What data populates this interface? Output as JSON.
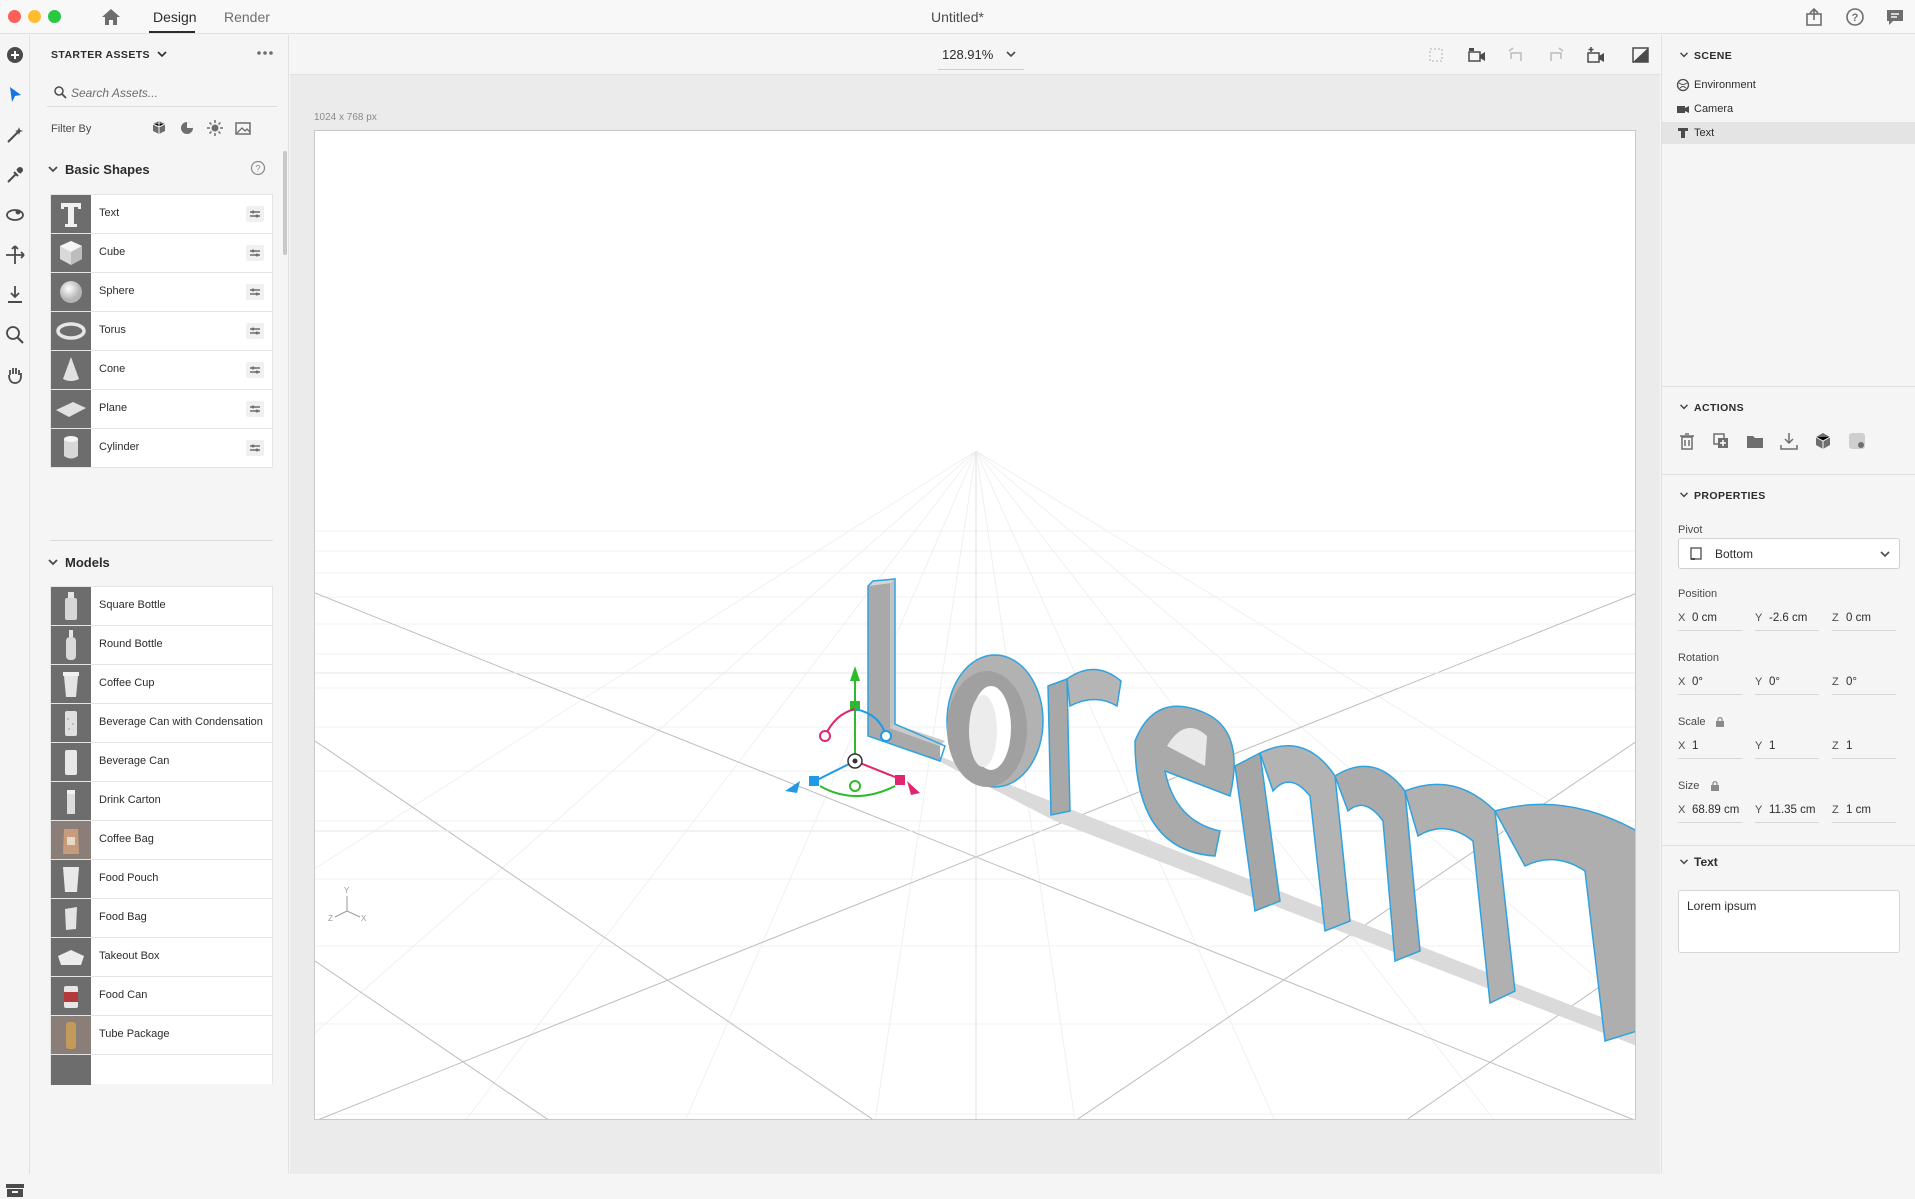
{
  "window": {
    "title": "Untitled*",
    "tabs": [
      {
        "label": "Design",
        "active": true
      },
      {
        "label": "Render",
        "active": false
      }
    ],
    "traffic_colors": [
      "#fe5f57",
      "#febc2e",
      "#28c840"
    ]
  },
  "tool_rail": {
    "tools": [
      "add-icon",
      "select-icon",
      "magic-select-icon",
      "eyedropper-icon",
      "orbit-icon",
      "move-icon",
      "drop-to-ground-icon",
      "zoom-icon",
      "pan-hand-icon"
    ],
    "bottom": "archive-icon"
  },
  "assets": {
    "header": "STARTER ASSETS",
    "search_placeholder": "Search Assets...",
    "filter_label": "Filter By",
    "basic_shapes": {
      "title": "Basic Shapes",
      "items": [
        "Text",
        "Cube",
        "Sphere",
        "Torus",
        "Cone",
        "Plane",
        "Cylinder"
      ]
    },
    "models": {
      "title": "Models",
      "items": [
        "Square Bottle",
        "Round Bottle",
        "Coffee Cup",
        "Beverage Can with Condensation",
        "Beverage Can",
        "Drink Carton",
        "Coffee Bag",
        "Food Pouch",
        "Food Bag",
        "Takeout Box",
        "Food Can",
        "Tube Package"
      ]
    }
  },
  "viewport": {
    "zoom": "128.91%",
    "canvas_size": "1024 x 768 px",
    "scene_text": "Lorem",
    "axis_labels": {
      "x": "X",
      "y": "Y",
      "z": "Z"
    }
  },
  "scene": {
    "header": "SCENE",
    "items": [
      {
        "label": "Environment",
        "icon": "environment-icon",
        "selected": false
      },
      {
        "label": "Camera",
        "icon": "camera-icon",
        "selected": false
      },
      {
        "label": "Text",
        "icon": "text-object-icon",
        "selected": true
      }
    ]
  },
  "actions": {
    "header": "ACTIONS",
    "icons": [
      "delete-icon",
      "duplicate-icon",
      "group-icon",
      "drop-to-ground-icon",
      "model-icon",
      "material-icon"
    ]
  },
  "properties": {
    "header": "PROPERTIES",
    "pivot_label": "Pivot",
    "pivot_value": "Bottom",
    "position_label": "Position",
    "position": {
      "x": "0 cm",
      "y": "-2.6 cm",
      "z": "0 cm"
    },
    "rotation_label": "Rotation",
    "rotation": {
      "x": "0°",
      "y": "0°",
      "z": "0°"
    },
    "scale_label": "Scale",
    "scale": {
      "x": "1",
      "y": "1",
      "z": "1"
    },
    "size_label": "Size",
    "size": {
      "x": "68.89 cm",
      "y": "11.35 cm",
      "z": "1 cm"
    },
    "axis_letters": {
      "x": "X",
      "y": "Y",
      "z": "Z"
    }
  },
  "text_section": {
    "title": "Text",
    "value": "Lorem ipsum"
  },
  "colors": {
    "selection_outline": "#2ea3e0",
    "gizmo_y": "#2dbb2d",
    "gizmo_x": "#e0266f",
    "gizmo_z": "#1e9ae6"
  }
}
